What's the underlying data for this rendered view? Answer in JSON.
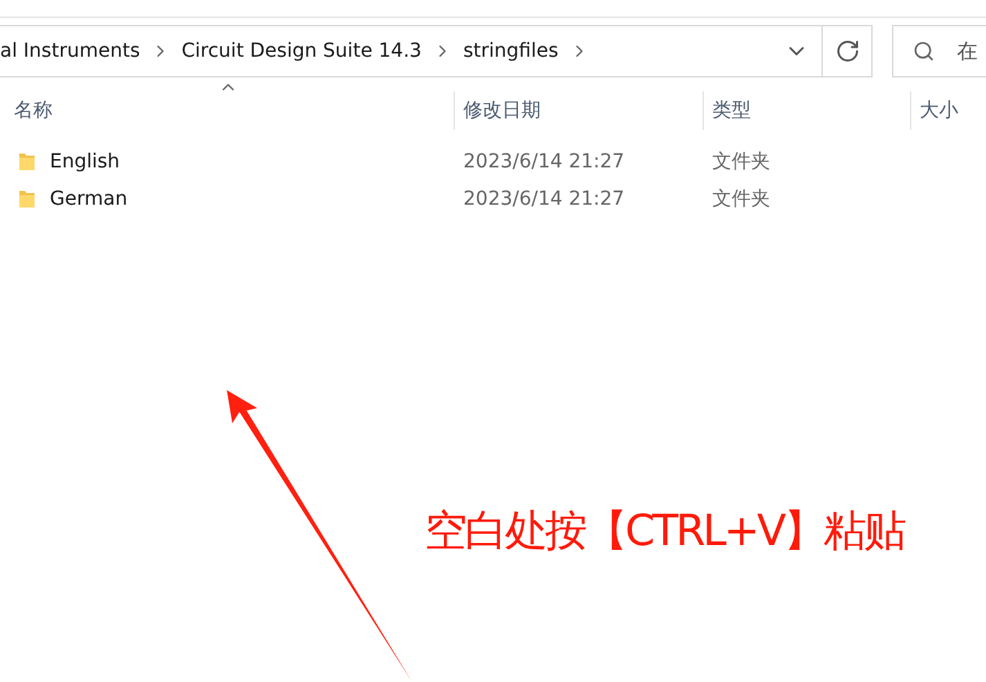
{
  "address_bar": {
    "breadcrumbs": [
      "al Instruments",
      "Circuit Design Suite 14.3",
      "stringfiles"
    ]
  },
  "search": {
    "placeholder": "在"
  },
  "table": {
    "columns": [
      "名称",
      "修改日期",
      "类型",
      "大小"
    ],
    "rows": [
      {
        "name": "English",
        "modified": "2023/6/14 21:27",
        "type": "文件夹"
      },
      {
        "name": "German",
        "modified": "2023/6/14 21:27",
        "type": "文件夹"
      }
    ]
  },
  "annotation": {
    "text": "空白处按【CTRL+V】粘贴"
  }
}
